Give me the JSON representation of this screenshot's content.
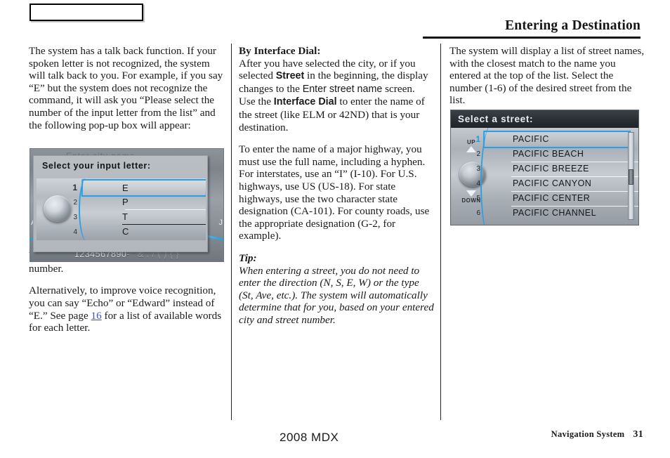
{
  "header": {
    "chapter_box_label": "",
    "title": "Entering a Destination"
  },
  "columns": {
    "left": {
      "para1": "The system has a talk back function. If your spoken letter is not recognized, the system will talk back to you. For example, if you say “E” but the system does not recognize the command, it will ask you “Please select the number of the input letter from the list” and the following pop-up box will appear:",
      "para2": "You should select a letter by saying the number.",
      "para3_a": "Alternatively, to improve voice recognition, you can say “Echo” or “Edward” instead of “E.” See page ",
      "para3_link": "16",
      "para3_b": " for a list of available words for each letter."
    },
    "middle": {
      "heading": "By Interface Dial:",
      "para1_a": "After you have selected the city, or if you selected ",
      "para1_b": "Street",
      "para1_c": " in the beginning, the display changes to the ",
      "para1_d": "Enter street name",
      "para1_e": " screen. Use the ",
      "para1_f": "Interface Dial",
      "para1_g": " to enter the name of the street (like ELM or 42ND) that is your destination.",
      "para2": "To enter the name of a major highway, you must use the full name, including a hyphen. For interstates, use an “I” (I-10). For U.S. highways, use US (US-18). For state highways, use the two character state designation (CA-101). For county roads, use the appropriate designation (G-2, for example).",
      "tip_heading": "Tip:",
      "tip_body": "When entering a street, you do not need to enter the direction (N, S, E, W) or the type (St, Ave, etc.). The system will automatically determine that for you, based on your entered city and street number."
    },
    "right": {
      "para1": "The system will display a list of street names, with the closest match to the name you entered at the top of the list. Select the number (1-6) of the desired street from the list."
    }
  },
  "nav_screen_input_letter": {
    "ghost_title": "Enter city name",
    "popup_title": "Select your input letter:",
    "rows": [
      {
        "num": "1",
        "label": "E",
        "selected": true
      },
      {
        "num": "2",
        "label": "P",
        "selected": false
      },
      {
        "num": "3",
        "label": "T",
        "selected": false
      },
      {
        "num": "4",
        "label": "C",
        "selected": false
      }
    ],
    "keyboard_digits": "1234567890",
    "keyboard_extra": "- ' & . / ( ) { }",
    "edge_left_label": "A",
    "edge_right_label": "J",
    "accent_color": "#2b9fe6"
  },
  "nav_screen_select_street": {
    "title": "Select a street:",
    "up_label": "UP",
    "down_label": "DOWN",
    "rows": [
      {
        "num": "1",
        "label": "PACIFIC",
        "selected": true
      },
      {
        "num": "2",
        "label": "PACIFIC BEACH",
        "selected": false
      },
      {
        "num": "3",
        "label": "PACIFIC BREEZE",
        "selected": false
      },
      {
        "num": "4",
        "label": "PACIFIC CANYON",
        "selected": false
      },
      {
        "num": "5",
        "label": "PACIFIC CENTER",
        "selected": false
      },
      {
        "num": "6",
        "label": "PACIFIC CHANNEL",
        "selected": false
      }
    ],
    "accent_color": "#2b9fe6"
  },
  "footer": {
    "model": "2008  MDX",
    "section": "Navigation System",
    "page_number": "31"
  }
}
